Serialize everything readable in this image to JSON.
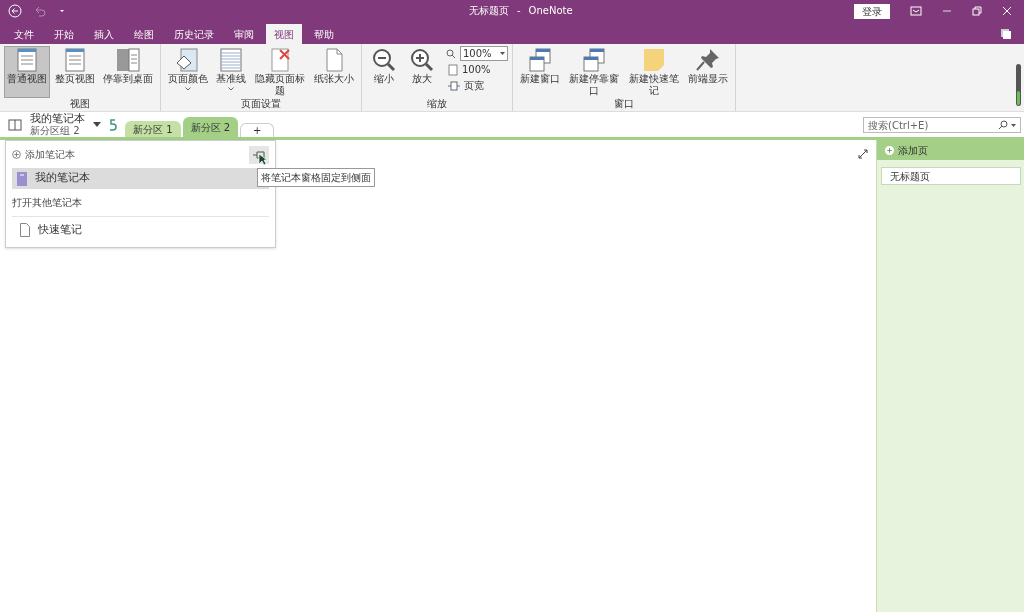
{
  "window": {
    "title": "无标题页",
    "separator": "-",
    "app": "OneNote",
    "sign_in": "登录"
  },
  "menu_tabs": [
    {
      "label": "文件",
      "selected": false
    },
    {
      "label": "开始",
      "selected": false
    },
    {
      "label": "插入",
      "selected": false
    },
    {
      "label": "绘图",
      "selected": false
    },
    {
      "label": "历史记录",
      "selected": false
    },
    {
      "label": "审阅",
      "selected": false
    },
    {
      "label": "视图",
      "selected": true
    },
    {
      "label": "帮助",
      "selected": false
    }
  ],
  "ribbon": [
    {
      "label": "视图",
      "items": [
        {
          "kind": "large",
          "label": "普通视图",
          "selected": true
        },
        {
          "kind": "large",
          "label": "整页视图",
          "selected": false
        },
        {
          "kind": "large",
          "label": "停靠到桌面",
          "selected": false
        }
      ]
    },
    {
      "label": "页面设置",
      "items": [
        {
          "kind": "large",
          "label": "页面颜色",
          "dropdown": true,
          "selected": false
        },
        {
          "kind": "large",
          "label": "基准线",
          "dropdown": true,
          "selected": false
        },
        {
          "kind": "large",
          "label": "隐藏页面标题",
          "selected": false
        },
        {
          "kind": "large",
          "label": "纸张大小",
          "selected": false
        }
      ]
    },
    {
      "label": "缩放",
      "items": [
        {
          "kind": "large",
          "label": "缩小",
          "selected": false
        },
        {
          "kind": "large",
          "label": "放大",
          "selected": false
        },
        {
          "kind": "zoom",
          "value": "100%",
          "small": [
            "100%",
            "页宽"
          ]
        }
      ]
    },
    {
      "label": "窗口",
      "items": [
        {
          "kind": "large",
          "label": "新建窗口",
          "selected": false
        },
        {
          "kind": "large",
          "label": "新建停靠窗口",
          "selected": false
        },
        {
          "kind": "large",
          "label": "新建快速笔记",
          "selected": false
        },
        {
          "kind": "large",
          "label": "前端显示",
          "selected": false
        }
      ]
    }
  ],
  "notebook_bar": {
    "notebook": "我的笔记本",
    "section_group": "新分区组 2",
    "sections": [
      {
        "label": "新分区 1",
        "selected": false
      },
      {
        "label": "新分区 2",
        "selected": true
      }
    ],
    "add_section": "+"
  },
  "notebook_pane": {
    "add": "添加笔记本",
    "notebooks": [
      {
        "label": "我的笔记本",
        "selected": true
      }
    ],
    "open_other": "打开其他笔记本",
    "quick_notes": "快速笔记",
    "tooltip": "将笔记本窗格固定到侧面"
  },
  "search": {
    "placeholder": "搜索(Ctrl+E)"
  },
  "pages_pane": {
    "add": "添加页",
    "pages": [
      {
        "title": "无标题页",
        "selected": true
      }
    ]
  }
}
